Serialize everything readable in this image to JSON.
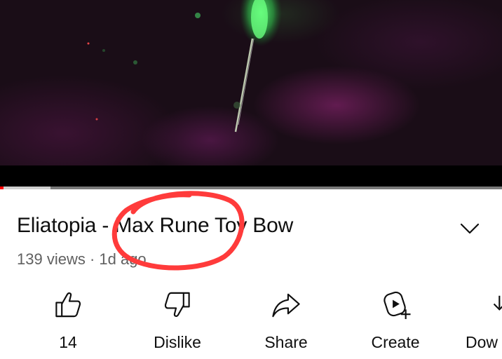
{
  "video": {
    "progress_played_fraction": 0.007,
    "buffered_fraction": 0.1
  },
  "title": "Eliatopia - Max Rune Toy Bow",
  "meta": "139 views · 1d ago",
  "actions": {
    "like_label": "14",
    "dislike_label": "Dislike",
    "share_label": "Share",
    "create_label": "Create",
    "download_label": "Dow"
  },
  "icons": {
    "like": "thumbs-up-icon",
    "dislike": "thumbs-down-icon",
    "share": "share-arrow-icon",
    "create": "create-icon",
    "download": "download-icon",
    "expand": "chevron-down-icon"
  },
  "colors": {
    "progress_played": "#ff0000",
    "annotation": "#ff3b3b"
  }
}
